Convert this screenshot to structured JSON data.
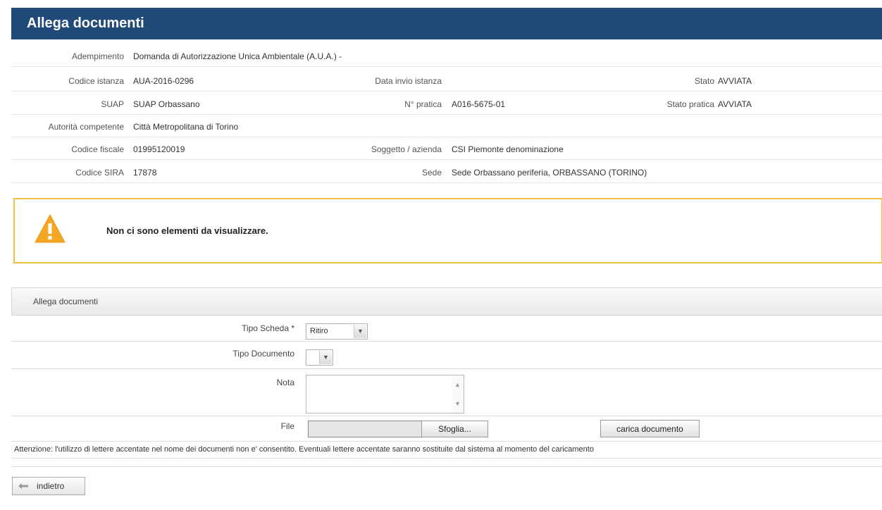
{
  "header": {
    "title": "Allega documenti"
  },
  "info": {
    "adempimento_label": "Adempimento",
    "adempimento_value": "Domanda di Autorizzazione Unica Ambientale (A.U.A.) -",
    "codice_istanza_label": "Codice istanza",
    "codice_istanza_value": "AUA-2016-0296",
    "data_invio_label": "Data invio istanza",
    "stato_label": "Stato",
    "stato_value": "AVVIATA",
    "suap_label": "SUAP",
    "suap_value": "SUAP Orbassano",
    "npratica_label": "N° pratica",
    "npratica_value": "A016-5675-01",
    "stato_pratica_label": "Stato pratica",
    "stato_pratica_value": "AVVIATA",
    "autorita_label": "Autorità competente",
    "autorita_value": "Città Metropolitana di Torino",
    "codice_fiscale_label": "Codice fiscale",
    "codice_fiscale_value": "01995120019",
    "soggetto_label": "Soggetto / azienda",
    "soggetto_value": "CSI Piemonte denominazione",
    "codice_sira_label": "Codice SIRA",
    "codice_sira_value": "17878",
    "sede_label": "Sede",
    "sede_value": "Sede Orbassano periferia, ORBASSANO (TORINO)"
  },
  "alert": {
    "message": "Non ci sono elementi da visualizzare.",
    "icon": "warning-icon"
  },
  "section": {
    "title": "Allega documenti"
  },
  "form": {
    "tipo_scheda_label": "Tipo Scheda *",
    "tipo_scheda_value": "Ritiro",
    "tipo_documento_label": "Tipo Documento",
    "tipo_documento_value": "",
    "nota_label": "Nota",
    "file_label": "File",
    "browse_label": "Sfoglia...",
    "upload_label": "carica documento"
  },
  "note": "Attenzione: l'utilizzo di lettere accentate nel nome dei documenti non e' consentito. Eventuali lettere accentate saranno sostituite dal sistema al momento del caricamento",
  "back": {
    "label": "indietro"
  },
  "colors": {
    "header_bg": "#1f4a7a",
    "alert_border": "#f0c040",
    "warning": "#f5a623"
  }
}
